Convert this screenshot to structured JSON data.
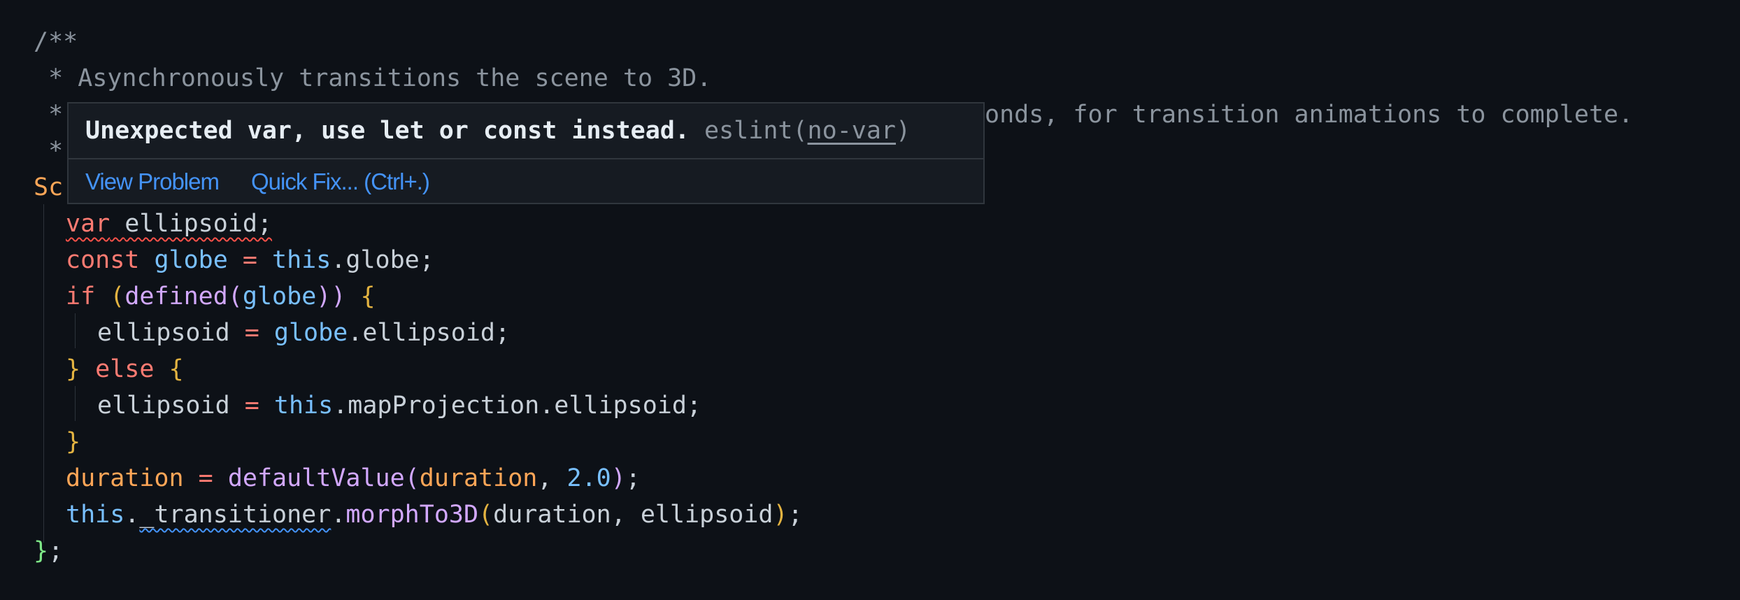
{
  "code": {
    "l1": "/**",
    "l2": " * Asynchronously transitions the scene to 3D.",
    "l3_star": " *",
    "l3_tail": "onds, for transition animations to complete.",
    "l4_star": " *",
    "l5_start": "Sc",
    "l6_var": "var",
    "l6_ident": "ellipsoid;",
    "l7_const": "const",
    "l7_ident": "globe",
    "l7_eq": "=",
    "l7_this": "this",
    "l7_rest": ".globe;",
    "l8_if": "if",
    "l8_open": "(",
    "l8_fn": "defined",
    "l8_fopen": "(",
    "l8_arg": "globe",
    "l8_close": "))",
    "l8_brace": "{",
    "l9_ident": "ellipsoid",
    "l9_eq": "=",
    "l9_obj": "globe",
    "l9_rest": ".ellipsoid;",
    "l10_close": "}",
    "l10_else": "else",
    "l10_brace": "{",
    "l11_ident": "ellipsoid",
    "l11_eq": "=",
    "l11_this": "this",
    "l11_rest": ".mapProjection.ellipsoid;",
    "l12_close": "}",
    "l13_ident": "duration",
    "l13_eq": "=",
    "l13_fn": "defaultValue",
    "l13_open": "(",
    "l13_arg1": "duration",
    "l13_comma": ",",
    "l13_num": "2.0",
    "l13_close": ")",
    "l13_semi": ";",
    "l14_this": "this",
    "l14_dot": ".",
    "l14_prop": "_transitioner",
    "l14_dot2": ".",
    "l14_fn": "morphTo3D",
    "l14_open": "(",
    "l14_args": "duration, ellipsoid",
    "l14_close": ")",
    "l14_semi": ";",
    "l15_close": "}",
    "l15_semi": ";"
  },
  "hover": {
    "message": "Unexpected var, use let or const instead.",
    "source_prefix": "eslint(",
    "rule_code": "no-var",
    "source_suffix": ")",
    "action_view": "View Problem",
    "action_fix": "Quick Fix... (Ctrl+.)"
  },
  "colors": {
    "background": "#0d1117",
    "error_squiggle": "#f85149",
    "info_squiggle": "#4493f8",
    "link": "#4493f8"
  }
}
